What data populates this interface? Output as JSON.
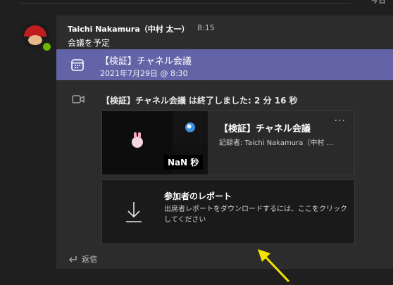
{
  "header": {
    "day_label": "今日"
  },
  "message": {
    "author": "Taichi Nakamura（中村 太一）",
    "time": "8:15",
    "text": "会議を予定"
  },
  "meeting": {
    "title": "【検証】チャネル会議",
    "datetime": "2021年7月29日 @ 8:30"
  },
  "meeting_ended": {
    "text": "【検証】チャネル会議 は終了しました: 2 分 16 秒"
  },
  "recording": {
    "title": "【検証】チャネル会議",
    "recorder": "記録者: Taichi Nakamura（中村 ...",
    "duration": "NaN 秒",
    "more_label": "···"
  },
  "attendance_report": {
    "title": "参加者のレポート",
    "description": "出席者レポートをダウンロードするには、ここをクリックしてください"
  },
  "reply": {
    "label": "返信"
  },
  "colors": {
    "accent": "#6264a7",
    "presence": "#6bb700",
    "annotation_arrow": "#f5e400"
  }
}
